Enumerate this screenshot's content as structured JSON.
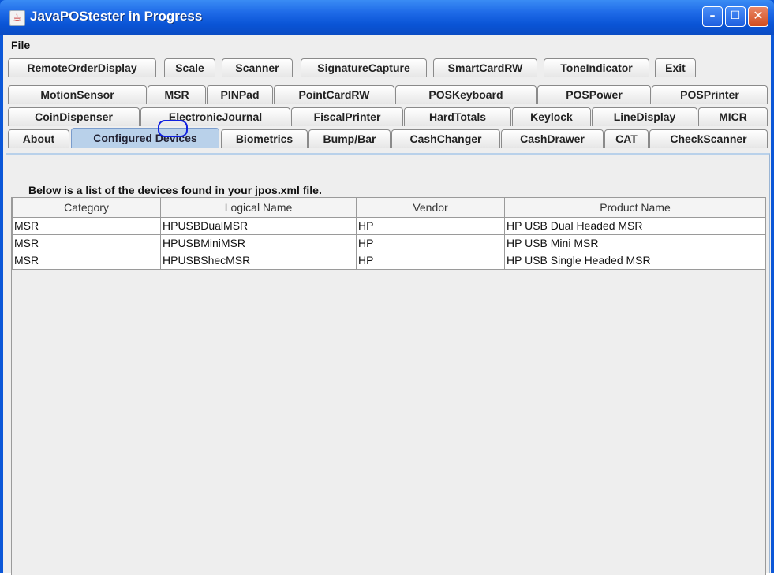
{
  "window": {
    "title": "JavaPOStester in Progress"
  },
  "menu": {
    "file": "File"
  },
  "tab_rows": [
    [
      "RemoteOrderDisplay",
      "Scale",
      "Scanner",
      "SignatureCapture",
      "SmartCardRW",
      "ToneIndicator",
      "Exit"
    ],
    [
      "MotionSensor",
      "MSR",
      "PINPad",
      "PointCardRW",
      "POSKeyboard",
      "POSPower",
      "POSPrinter"
    ],
    [
      "CoinDispenser",
      "ElectronicJournal",
      "FiscalPrinter",
      "HardTotals",
      "Keylock",
      "LineDisplay",
      "MICR"
    ],
    [
      "About",
      "Configured Devices",
      "Biometrics",
      "Bump/Bar",
      "CashChanger",
      "CashDrawer",
      "CAT",
      "CheckScanner"
    ]
  ],
  "selected_tab": "Configured Devices",
  "highlighted_tab": "MSR",
  "panel": {
    "heading": "Below is a list of the devices found in your jpos.xml file."
  },
  "device_table": {
    "columns": [
      "Category",
      "Logical Name",
      "Vendor",
      "Product Name"
    ],
    "rows": [
      [
        "MSR",
        "HPUSBDualMSR",
        "HP",
        "HP USB Dual Headed MSR"
      ],
      [
        "MSR",
        "HPUSBMiniMSR",
        "HP",
        "HP USB Mini MSR"
      ],
      [
        "MSR",
        "HPUSBShecMSR",
        "HP",
        "HP USB Single Headed MSR"
      ]
    ]
  },
  "colors": {
    "title_bar": "#0a54d6",
    "selected_tab": "#b9d1ea",
    "highlight_circle": "#1020e0"
  }
}
